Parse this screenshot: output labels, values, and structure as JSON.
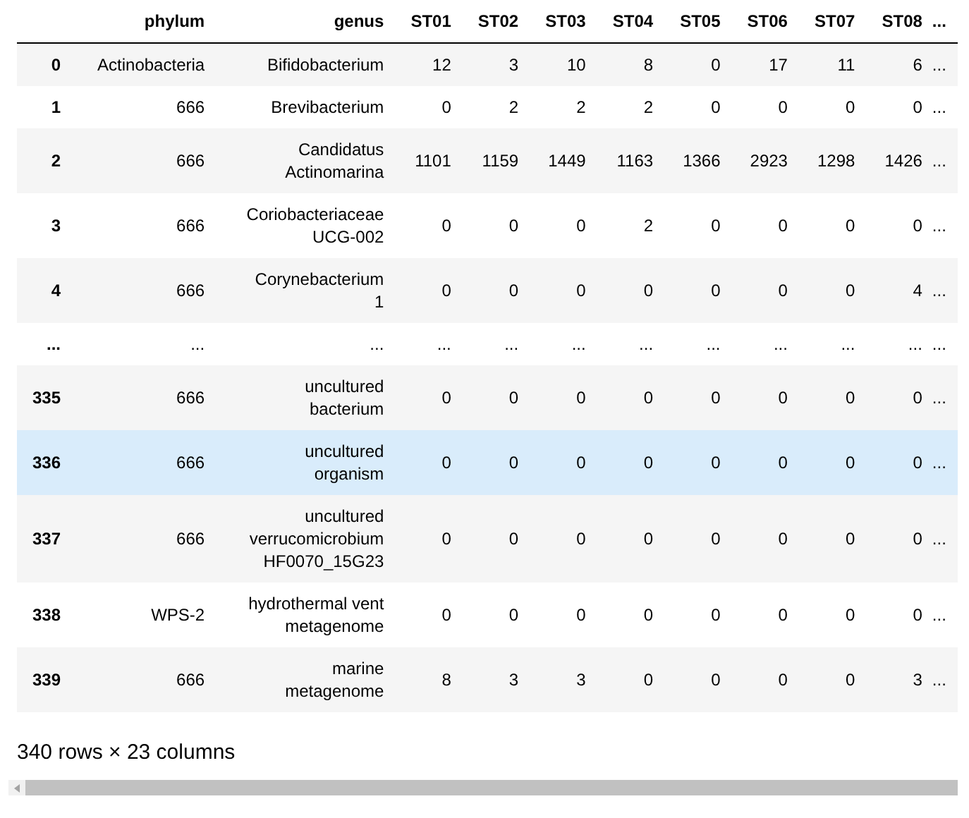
{
  "table": {
    "columns": [
      "phylum",
      "genus",
      "ST01",
      "ST02",
      "ST03",
      "ST04",
      "ST05",
      "ST06",
      "ST07",
      "ST08",
      "..."
    ],
    "rows": [
      {
        "index": "0",
        "hovered": false,
        "cells": [
          "Actinobacteria",
          "Bifidobacterium",
          "12",
          "3",
          "10",
          "8",
          "0",
          "17",
          "11",
          "6",
          "..."
        ]
      },
      {
        "index": "1",
        "hovered": false,
        "cells": [
          "666",
          "Brevibacterium",
          "0",
          "2",
          "2",
          "2",
          "0",
          "0",
          "0",
          "0",
          "..."
        ]
      },
      {
        "index": "2",
        "hovered": false,
        "cells": [
          "666",
          "Candidatus Actinomarina",
          "1101",
          "1159",
          "1449",
          "1163",
          "1366",
          "2923",
          "1298",
          "1426",
          "..."
        ]
      },
      {
        "index": "3",
        "hovered": false,
        "cells": [
          "666",
          "Coriobacteriaceae UCG-002",
          "0",
          "0",
          "0",
          "2",
          "0",
          "0",
          "0",
          "0",
          "..."
        ]
      },
      {
        "index": "4",
        "hovered": false,
        "cells": [
          "666",
          "Corynebacterium 1",
          "0",
          "0",
          "0",
          "0",
          "0",
          "0",
          "0",
          "4",
          "..."
        ]
      },
      {
        "index": "...",
        "hovered": false,
        "cells": [
          "...",
          "...",
          "...",
          "...",
          "...",
          "...",
          "...",
          "...",
          "...",
          "...",
          "..."
        ]
      },
      {
        "index": "335",
        "hovered": false,
        "cells": [
          "666",
          "uncultured bacterium",
          "0",
          "0",
          "0",
          "0",
          "0",
          "0",
          "0",
          "0",
          "..."
        ]
      },
      {
        "index": "336",
        "hovered": true,
        "cells": [
          "666",
          "uncultured organism",
          "0",
          "0",
          "0",
          "0",
          "0",
          "0",
          "0",
          "0",
          "..."
        ]
      },
      {
        "index": "337",
        "hovered": false,
        "cells": [
          "666",
          "uncultured verrucomicrobium HF0070_15G23",
          "0",
          "0",
          "0",
          "0",
          "0",
          "0",
          "0",
          "0",
          "..."
        ]
      },
      {
        "index": "338",
        "hovered": false,
        "cells": [
          "WPS-2",
          "hydrothermal vent metagenome",
          "0",
          "0",
          "0",
          "0",
          "0",
          "0",
          "0",
          "0",
          "..."
        ]
      },
      {
        "index": "339",
        "hovered": false,
        "cells": [
          "666",
          "marine metagenome",
          "8",
          "3",
          "3",
          "0",
          "0",
          "0",
          "0",
          "3",
          "..."
        ]
      }
    ]
  },
  "footer": "340 rows × 23 columns"
}
